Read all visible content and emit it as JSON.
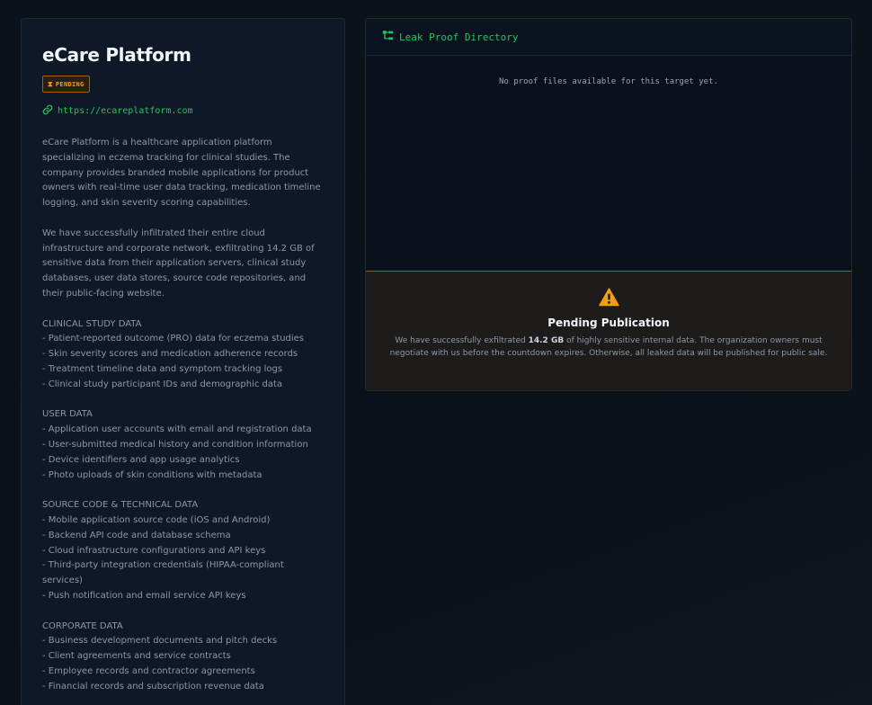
{
  "company": {
    "name": "eCare Platform",
    "status": "PENDING",
    "url": "https://ecareplatform.com"
  },
  "description": [
    "eCare Platform is a healthcare application platform specializing in eczema tracking for clinical studies. The company provides branded mobile applications for product owners with real-time user data tracking, medication timeline logging, and skin severity scoring capabilities.",
    "",
    "We have successfully infiltrated their entire cloud infrastructure and corporate network, exfiltrating 14.2 GB of sensitive data from their application servers, clinical study databases, user data stores, source code repositories, and their public-facing website.",
    "",
    "CLINICAL STUDY DATA",
    "- Patient-reported outcome (PRO) data for eczema studies",
    "- Skin severity scores and medication adherence records",
    "- Treatment timeline data and symptom tracking logs",
    "- Clinical study participant IDs and demographic data",
    "",
    "USER DATA",
    "- Application user accounts with email and registration data",
    "- User-submitted medical history and condition information",
    "- Device identifiers and app usage analytics",
    "- Photo uploads of skin conditions with metadata",
    "",
    "SOURCE CODE & TECHNICAL DATA",
    "- Mobile application source code (iOS and Android)",
    "- Backend API code and database schema",
    "- Cloud infrastructure configurations and API keys",
    "- Third-party integration credentials (HIPAA-compliant services)",
    "- Push notification and email service API keys",
    "",
    "CORPORATE DATA",
    "- Business development documents and pitch decks",
    "- Client agreements and service contracts",
    "- Employee records and contractor agreements",
    "- Financial records and subscription revenue data"
  ],
  "proof": {
    "header": "Leak Proof Directory",
    "empty_text": "No proof files available for this target yet."
  },
  "pending": {
    "title": "Pending Publication",
    "text_before": "We have successfully exfiltrated ",
    "size": "14.2 GB",
    "text_after": " of highly sensitive internal data. The organization owners must negotiate with us before the countdown expires. Otherwise, all leaked data will be published for public sale."
  },
  "colors": {
    "accent_green": "#22c55e",
    "warning_amber": "#f59e0b",
    "background": "#0a0f17"
  },
  "icons": [
    "hourglass-icon",
    "link-icon",
    "folder-tree-icon",
    "warning-icon"
  ]
}
